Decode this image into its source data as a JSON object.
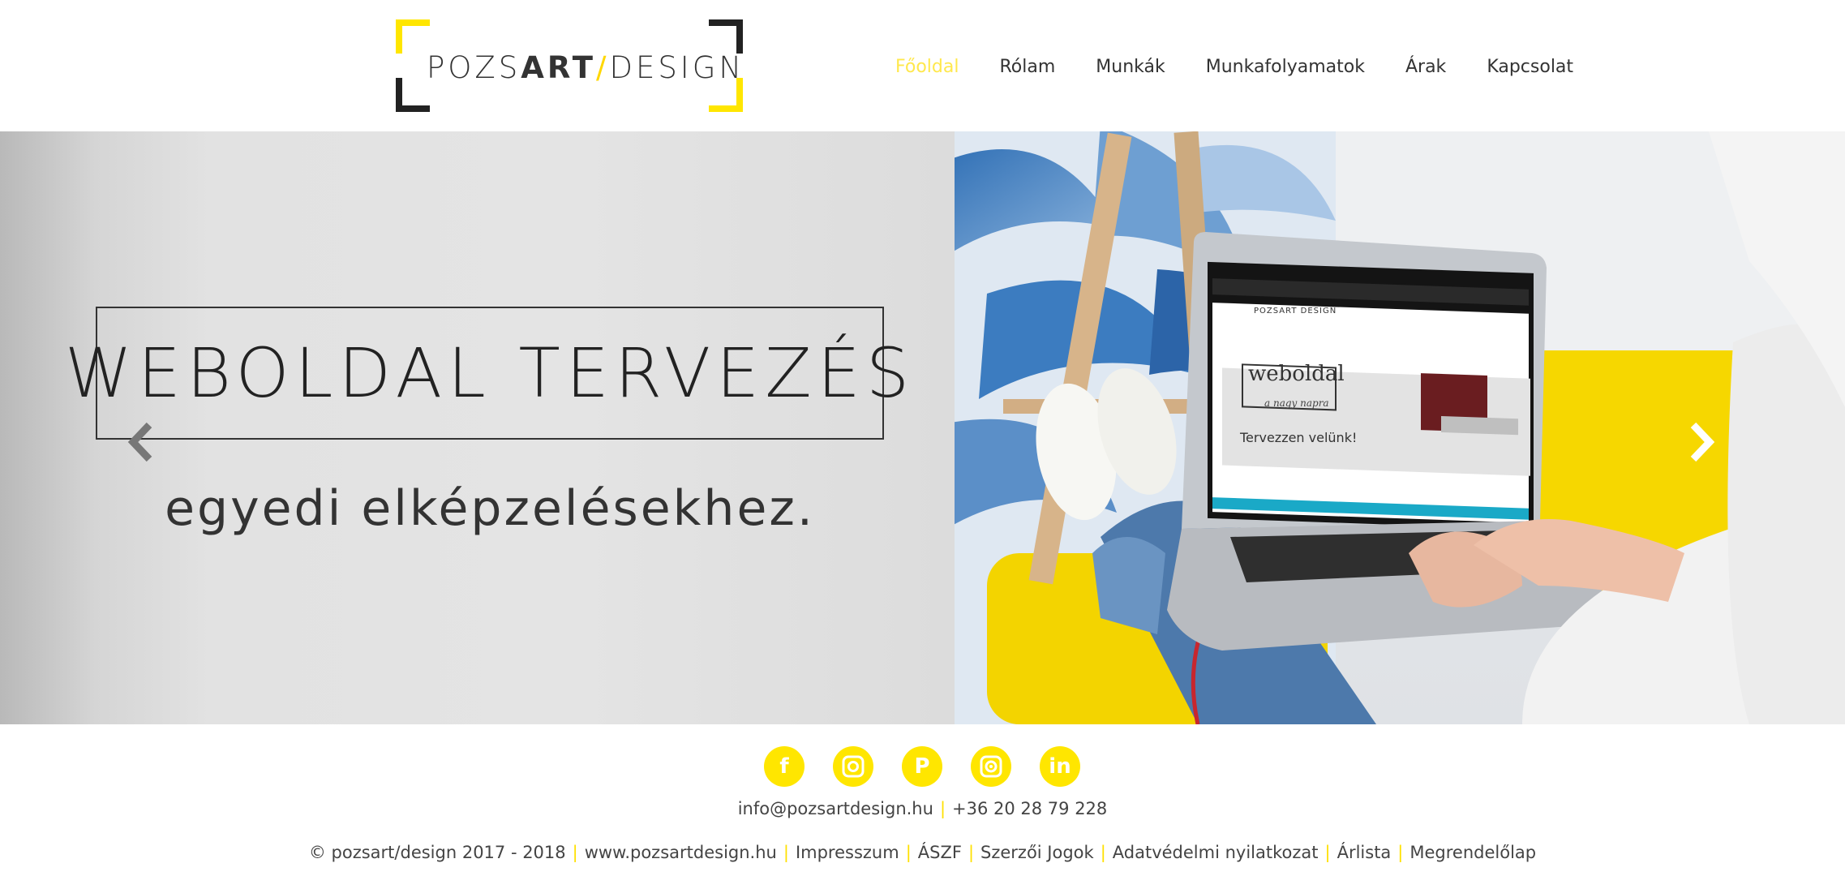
{
  "header": {
    "logo": {
      "part1": "POZS",
      "part2": "ART",
      "slash": "/",
      "part3": "DESIGN"
    },
    "nav": [
      {
        "label": "Főoldal",
        "active": true
      },
      {
        "label": "Rólam",
        "active": false
      },
      {
        "label": "Munkák",
        "active": false
      },
      {
        "label": "Munkafolyamatok",
        "active": false
      },
      {
        "label": "Árak",
        "active": false
      },
      {
        "label": "Kapcsolat",
        "active": false
      }
    ]
  },
  "hero": {
    "title": "WEBOLDAL TERVEZÉS",
    "subtitle": "egyedi elképzelésekhez.",
    "prev_icon": "chevron-left-icon",
    "next_icon": "chevron-right-icon",
    "laptop_screen": {
      "logo": "POZSART DESIGN",
      "headline": "weboldal",
      "tagline": "a nagy napra",
      "cta": "Tervezzen velünk!"
    }
  },
  "footer": {
    "social": [
      {
        "name": "facebook-icon",
        "glyph": "f"
      },
      {
        "name": "instagram-icon",
        "glyph": "◘"
      },
      {
        "name": "pinterest-icon",
        "glyph": "P"
      },
      {
        "name": "other-social-icon",
        "glyph": "◎"
      },
      {
        "name": "linkedin-icon",
        "glyph": "in"
      }
    ],
    "email": "info@pozsartdesign.hu",
    "phone": "+36 20 28 79 228",
    "copyright": "© pozsart/design 2017 - 2018",
    "links": [
      "www.pozsartdesign.hu",
      "Impresszum",
      "ÁSZF",
      "Szerzői Jogok",
      "Adatvédelmi nyilatkozat",
      "Árlista",
      "Megrendelőlap"
    ],
    "separator": "|"
  },
  "colors": {
    "accent": "#ffe600",
    "text": "#333333",
    "nav_active": "#ffe84d"
  }
}
